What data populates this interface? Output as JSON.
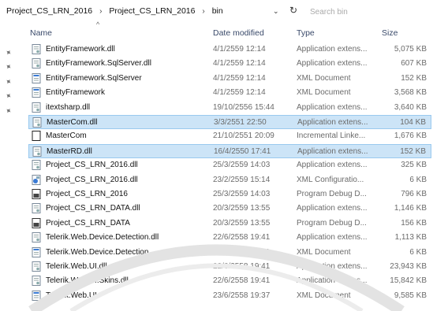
{
  "breadcrumb": [
    "Project_CS_LRN_2016",
    "Project_CS_LRN_2016",
    "bin"
  ],
  "breadcrumb_sep": "›",
  "search": {
    "placeholder": "Search bin"
  },
  "columns": {
    "name": "Name",
    "date": "Date modified",
    "type": "Type",
    "size": "Size"
  },
  "quick_access_pins": 5,
  "files": [
    {
      "name": "EntityFramework.dll",
      "date": "4/1/2559 12:14",
      "type": "Application extens...",
      "size": "5,075 KB",
      "icon": "dll-file-icon",
      "selected": false
    },
    {
      "name": "EntityFramework.SqlServer.dll",
      "date": "4/1/2559 12:14",
      "type": "Application extens...",
      "size": "607 KB",
      "icon": "dll-file-icon",
      "selected": false
    },
    {
      "name": "EntityFramework.SqlServer",
      "date": "4/1/2559 12:14",
      "type": "XML Document",
      "size": "152 KB",
      "icon": "xml-file-icon",
      "selected": false
    },
    {
      "name": "EntityFramework",
      "date": "4/1/2559 12:14",
      "type": "XML Document",
      "size": "3,568 KB",
      "icon": "xml-file-icon",
      "selected": false
    },
    {
      "name": "itextsharp.dll",
      "date": "19/10/2556 15:44",
      "type": "Application extens...",
      "size": "3,640 KB",
      "icon": "dll-file-icon",
      "selected": false
    },
    {
      "name": "MasterCom.dll",
      "date": "3/3/2551 22:50",
      "type": "Application extens...",
      "size": "104 KB",
      "icon": "dll-file-icon",
      "selected": true
    },
    {
      "name": "MasterCom",
      "date": "21/10/2551 20:09",
      "type": "Incremental Linke...",
      "size": "1,676 KB",
      "icon": "ilk-file-icon",
      "selected": false
    },
    {
      "name": "MasterRD.dll",
      "date": "16/4/2550 17:41",
      "type": "Application extens...",
      "size": "152 KB",
      "icon": "dll-file-icon",
      "selected": true
    },
    {
      "name": "Project_CS_LRN_2016.dll",
      "date": "25/3/2559 14:03",
      "type": "Application extens...",
      "size": "325 KB",
      "icon": "dll-file-icon",
      "selected": false
    },
    {
      "name": "Project_CS_LRN_2016.dll",
      "date": "23/2/2559 15:14",
      "type": "XML Configuratio...",
      "size": "6 KB",
      "icon": "config-file-icon",
      "selected": false
    },
    {
      "name": "Project_CS_LRN_2016",
      "date": "25/3/2559 14:03",
      "type": "Program Debug D...",
      "size": "796 KB",
      "icon": "pdb-file-icon",
      "selected": false
    },
    {
      "name": "Project_CS_LRN_DATA.dll",
      "date": "20/3/2559 13:55",
      "type": "Application extens...",
      "size": "1,146 KB",
      "icon": "dll-file-icon",
      "selected": false
    },
    {
      "name": "Project_CS_LRN_DATA",
      "date": "20/3/2559 13:55",
      "type": "Program Debug D...",
      "size": "156 KB",
      "icon": "pdb-file-icon",
      "selected": false
    },
    {
      "name": "Telerik.Web.Device.Detection.dll",
      "date": "22/6/2558 19:41",
      "type": "Application extens...",
      "size": "1,113 KB",
      "icon": "dll-file-icon",
      "selected": false
    },
    {
      "name": "Telerik.Web.Device.Detection",
      "date": "23/6/2558 19:41",
      "type": "XML Document",
      "size": "6 KB",
      "icon": "xml-file-icon",
      "selected": false
    },
    {
      "name": "Telerik.Web.UI.dll",
      "date": "22/6/2558 19:41",
      "type": "Application extens...",
      "size": "23,943 KB",
      "icon": "dll-file-icon",
      "selected": false
    },
    {
      "name": "Telerik.Web.UI.Skins.dll",
      "date": "22/6/2558 19:41",
      "type": "Application extens...",
      "size": "15,842 KB",
      "icon": "dll-file-icon",
      "selected": false
    },
    {
      "name": "Telerik.Web.UI",
      "date": "23/6/2558 19:37",
      "type": "XML Document",
      "size": "9,585 KB",
      "icon": "xml-file-icon",
      "selected": false
    }
  ]
}
